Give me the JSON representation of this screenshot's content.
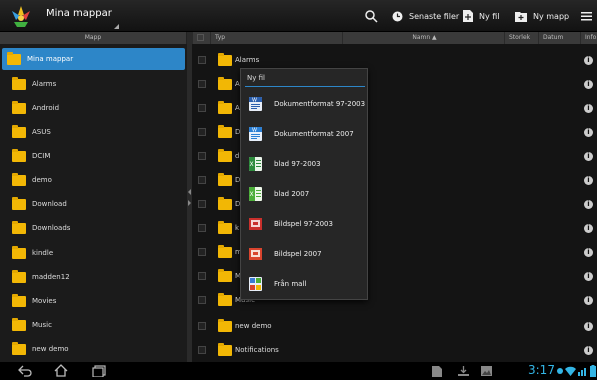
{
  "actionbar": {
    "title": "Mina mappar",
    "recent_label": "Senaste filer",
    "new_file_label": "Ny fil",
    "new_folder_label": "Ny mapp"
  },
  "columns": {
    "left_header": "Mapp",
    "type": "Typ",
    "name": "Namn ▲",
    "size": "Storlek",
    "date": "Datum",
    "info": "Info"
  },
  "tree": {
    "root": "Mina mappar",
    "items": [
      "Alarms",
      "Android",
      "ASUS",
      "DCIM",
      "demo",
      "Download",
      "Downloads",
      "kindle",
      "madden12",
      "Movies",
      "Music",
      "new demo"
    ]
  },
  "files": {
    "rows": [
      {
        "name": "Alarms"
      },
      {
        "name": "A"
      },
      {
        "name": "A"
      },
      {
        "name": "D"
      },
      {
        "name": "d"
      },
      {
        "name": "D"
      },
      {
        "name": "D"
      },
      {
        "name": "k"
      },
      {
        "name": "m"
      },
      {
        "name": "M"
      },
      {
        "name": "Music"
      },
      {
        "name": "new demo"
      },
      {
        "name": "Notifications"
      }
    ]
  },
  "popup": {
    "title": "Ny fil",
    "items": [
      {
        "label": "Dokumentformat 97-2003",
        "icon": "word-doc-icon",
        "color": "#2b5fad"
      },
      {
        "label": "Dokumentformat 2007",
        "icon": "word-docx-icon",
        "color": "#2b7fd4"
      },
      {
        "label": "blad 97-2003",
        "icon": "excel-xls-icon",
        "color": "#2e8b3d"
      },
      {
        "label": "blad 2007",
        "icon": "excel-xlsx-icon",
        "color": "#4cae3a"
      },
      {
        "label": "Bildspel 97-2003",
        "icon": "powerpoint-ppt-icon",
        "color": "#c9302c"
      },
      {
        "label": "Bildspel 2007",
        "icon": "powerpoint-pptx-icon",
        "color": "#d9442e"
      },
      {
        "label": "Från mall",
        "icon": "template-icon",
        "color": "#3a7bd5"
      }
    ]
  },
  "statusbar": {
    "time": "3:17"
  },
  "colors": {
    "accent": "#2d86c8",
    "folder": "#f2b705",
    "clock": "#33b5e5"
  }
}
